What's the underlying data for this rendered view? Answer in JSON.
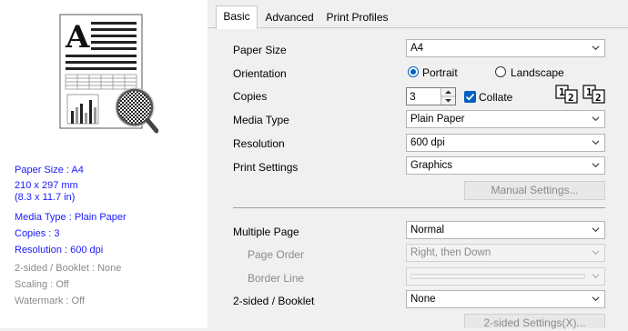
{
  "tabs": [
    "Basic",
    "Advanced",
    "Print Profiles"
  ],
  "preview": {
    "paper_size": "Paper Size : A4",
    "dimensions_mm": "210 x 297 mm",
    "dimensions_in": "(8.3 x 11.7 in)",
    "media_type": "Media Type : Plain Paper",
    "copies": "Copies : 3",
    "resolution": "Resolution : 600 dpi",
    "two_sided": "2-sided / Booklet : None",
    "scaling": "Scaling : Off",
    "watermark": "Watermark : Off"
  },
  "form": {
    "paper_size": {
      "label": "Paper Size",
      "value": "A4"
    },
    "orientation": {
      "label": "Orientation",
      "portrait": "Portrait",
      "landscape": "Landscape",
      "selected": "Portrait"
    },
    "copies": {
      "label": "Copies",
      "value": "3",
      "collate": "Collate",
      "collate_checked": true
    },
    "media_type": {
      "label": "Media Type",
      "value": "Plain Paper"
    },
    "resolution": {
      "label": "Resolution",
      "value": "600 dpi"
    },
    "print_settings": {
      "label": "Print Settings",
      "value": "Graphics"
    },
    "manual_settings": "Manual Settings...",
    "multiple_page": {
      "label": "Multiple Page",
      "value": "Normal"
    },
    "page_order": {
      "label": "Page Order",
      "value": "Right, then Down"
    },
    "border_line": {
      "label": "Border Line",
      "value": ""
    },
    "two_sided": {
      "label": "2-sided / Booklet",
      "value": "None"
    },
    "two_sided_settings": "2-sided Settings(X)..."
  },
  "collate_icons": [
    [
      "1",
      "2"
    ],
    [
      "1",
      "2"
    ]
  ],
  "colors": {
    "accent": "#0060c0",
    "info_blue": "#1a1aff",
    "disabled": "#8a8a8a"
  }
}
